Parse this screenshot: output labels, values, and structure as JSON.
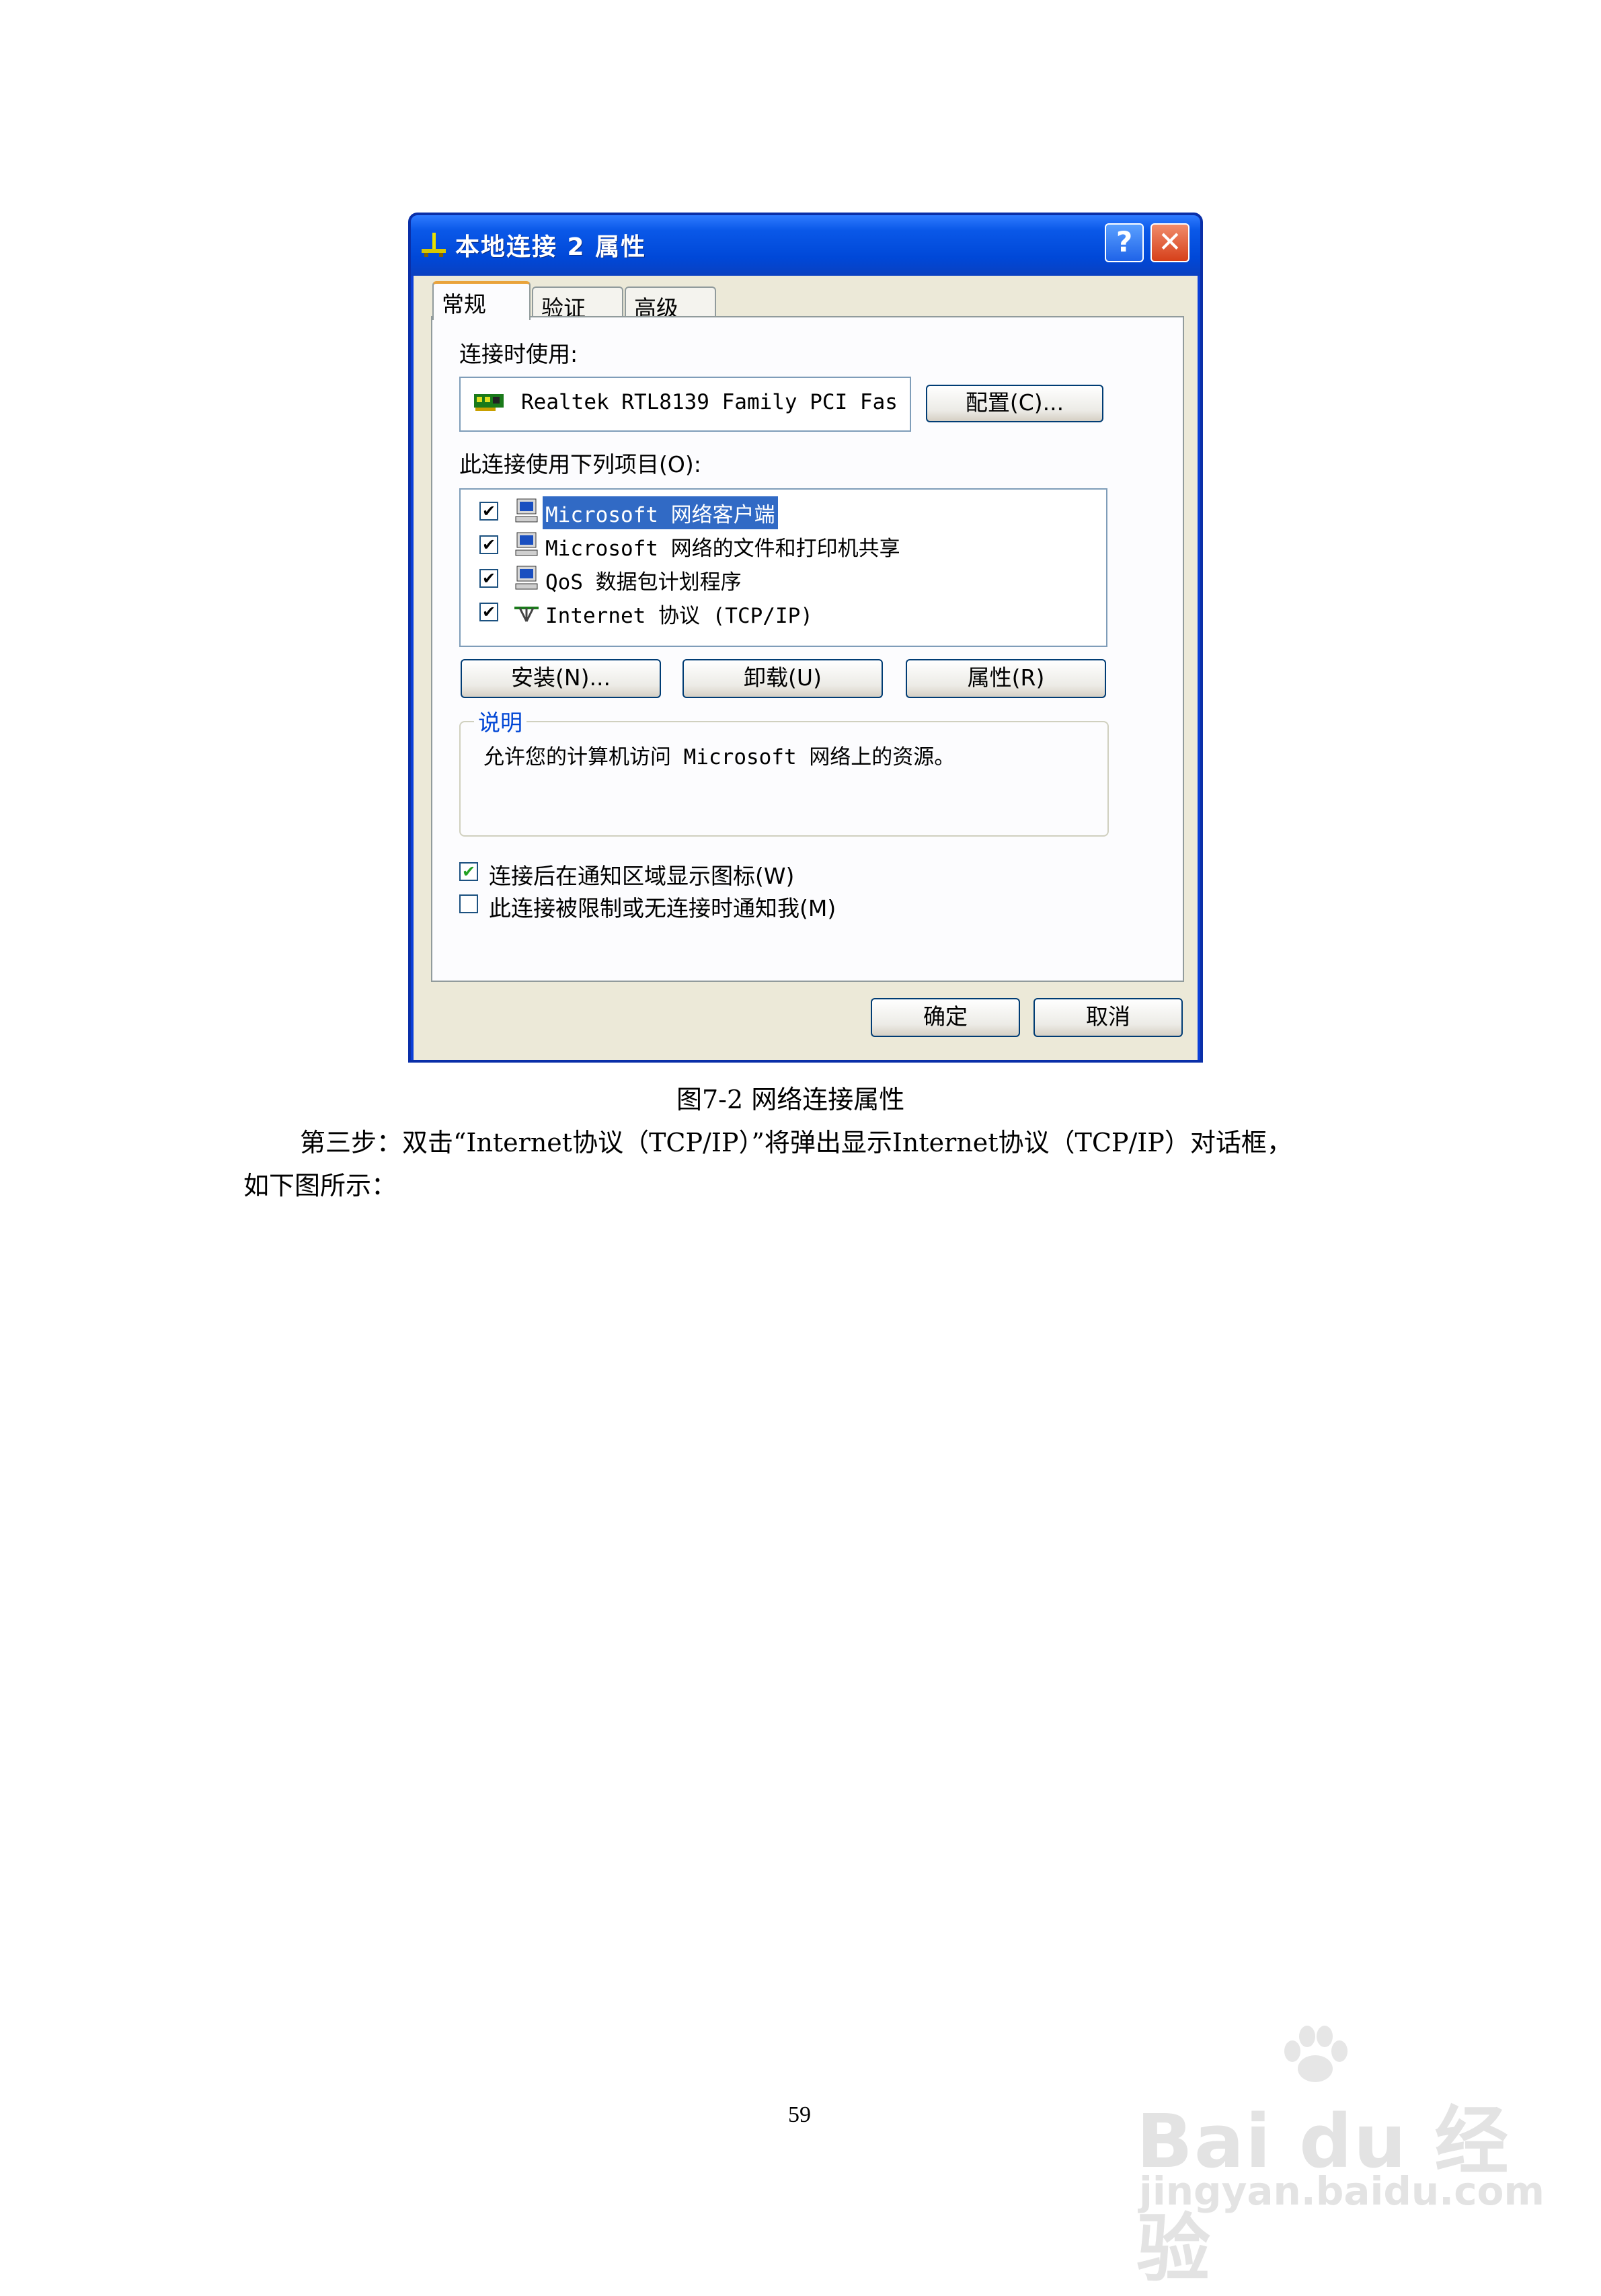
{
  "dialog": {
    "title": "本地连接 2 属性",
    "help_glyph": "?",
    "close_glyph": "✕",
    "tabs": [
      "常规",
      "验证",
      "高级"
    ],
    "connect_using_label": "连接时使用:",
    "adapter_name": "Realtek RTL8139 Family PCI Fas",
    "configure_button": "配置(C)...",
    "items_label": "此连接使用下列项目(O):",
    "items": [
      {
        "label": "Microsoft 网络客户端",
        "checked": true,
        "selected": true,
        "icon": "computer-icon"
      },
      {
        "label": "Microsoft 网络的文件和打印机共享",
        "checked": true,
        "selected": false,
        "icon": "computer-icon"
      },
      {
        "label": "QoS 数据包计划程序",
        "checked": true,
        "selected": false,
        "icon": "computer-icon"
      },
      {
        "label": "Internet 协议 (TCP/IP)",
        "checked": true,
        "selected": false,
        "icon": "network-protocol-icon"
      }
    ],
    "install_button": "安装(N)...",
    "uninstall_button": "卸载(U)",
    "properties_button": "属性(R)",
    "description_title": "说明",
    "description_text": "允许您的计算机访问 Microsoft 网络上的资源。",
    "show_icon_option": {
      "label": "连接后在通知区域显示图标(W)",
      "checked": true
    },
    "notify_option": {
      "label": "此连接被限制或无连接时通知我(M)",
      "checked": false
    },
    "ok_button": "确定",
    "cancel_button": "取消"
  },
  "caption": "图7-2 网络连接属性",
  "paragraph_line1": "第三步：双击“Internet协议（TCP/IP）”将弹出显示Internet协议（TCP/IP）对话框，",
  "paragraph_line2": "如下图所示：",
  "page_number": "59",
  "watermark": {
    "brand": "Bai du 经验",
    "url": "jingyan.baidu.com"
  }
}
